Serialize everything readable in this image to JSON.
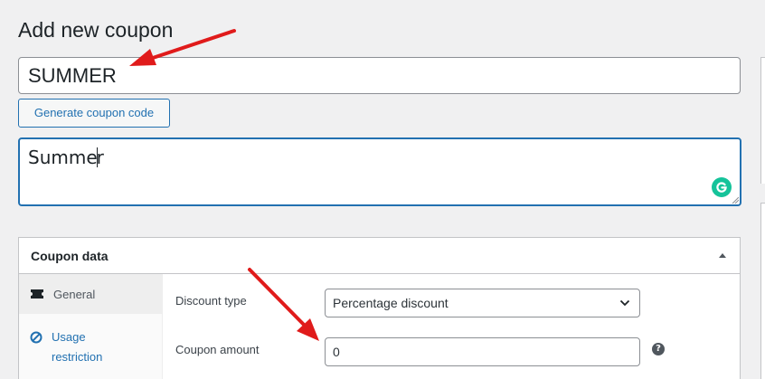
{
  "page": {
    "title": "Add new coupon"
  },
  "coupon": {
    "code_value": "SUMMER",
    "generate_button_label": "Generate coupon code",
    "description_value_before_caret": "Summe",
    "description_value_after_caret": "r"
  },
  "coupon_data": {
    "title": "Coupon data",
    "tabs": [
      {
        "label": "General",
        "icon": "ticket-icon",
        "active": true
      },
      {
        "label": "Usage restriction",
        "icon": "block-icon",
        "active": false
      }
    ],
    "fields": {
      "discount_type_label": "Discount type",
      "discount_type_value": "Percentage discount",
      "coupon_amount_label": "Coupon amount",
      "coupon_amount_value": "0",
      "help_glyph": "?"
    }
  },
  "colors": {
    "accent": "#2271b1",
    "annotation_arrow": "#e01b1b",
    "grammarly": "#15c39a"
  }
}
